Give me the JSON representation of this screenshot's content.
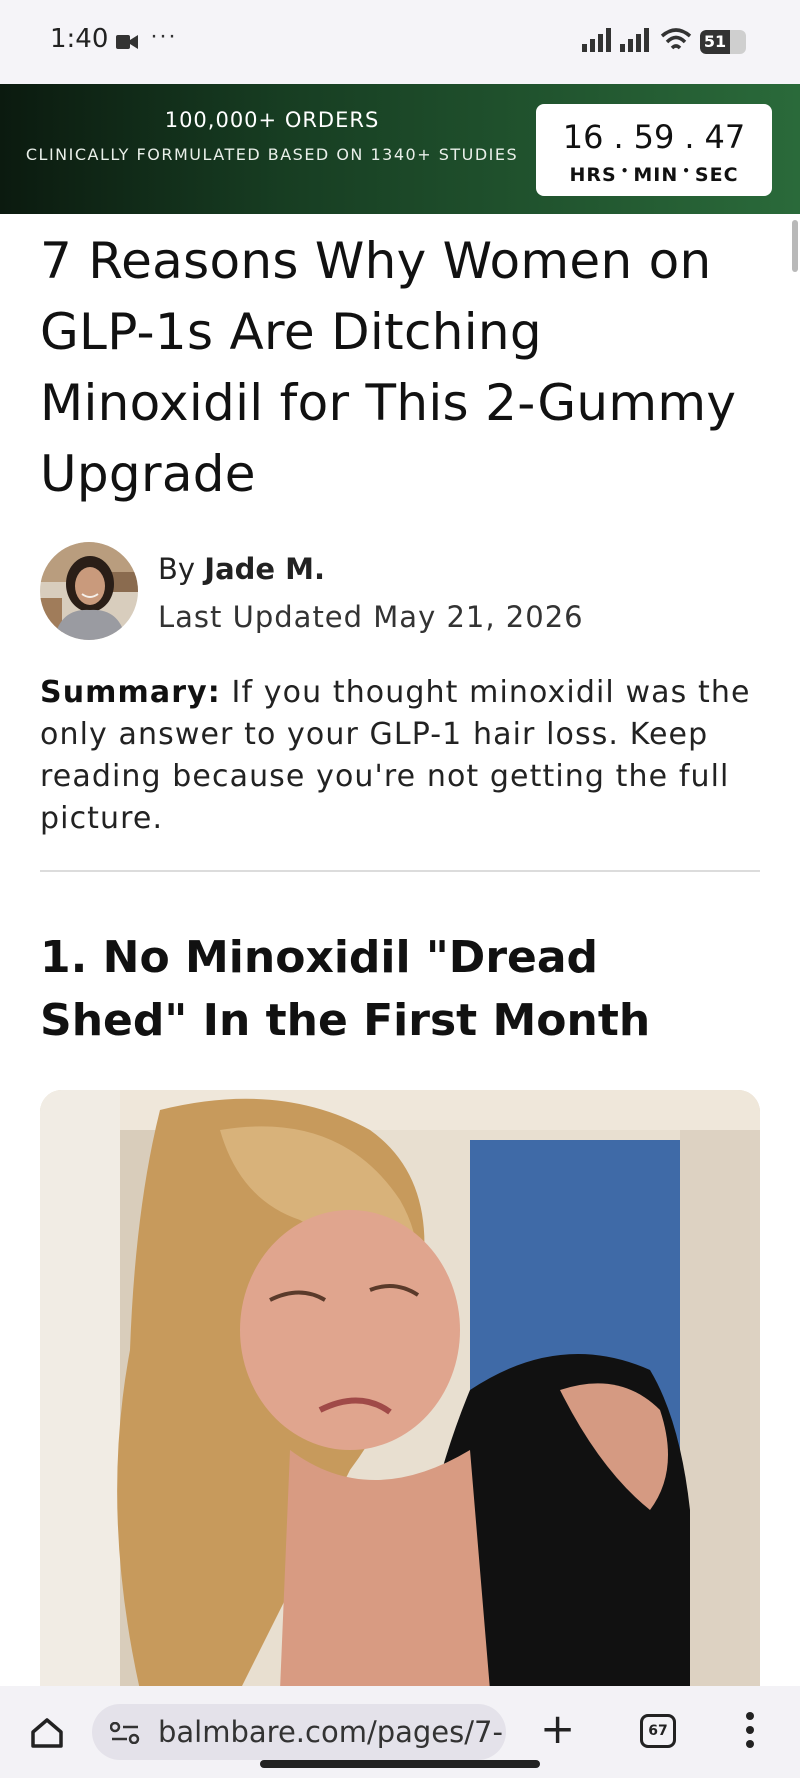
{
  "status_bar": {
    "time": "1:40",
    "overflow": "···",
    "battery_level": "51",
    "icons": [
      "video-camera-icon",
      "signal-icon",
      "wifi-icon",
      "battery-icon"
    ]
  },
  "promo_banner": {
    "title": "100,000+ ORDERS",
    "subtitle": "CLINICALLY FORMULATED BASED ON 1340+ STUDIES",
    "timer": {
      "hours": "16",
      "minutes": "59",
      "seconds": "47",
      "hours_label": "HRS",
      "minutes_label": "MIN",
      "seconds_label": "SEC"
    },
    "colors": {
      "dark": "#0b1a0f",
      "mid": "#173d22",
      "light": "#2a6a3a"
    }
  },
  "article": {
    "headline": "7 Reasons Why Women on GLP-1s Are Ditching Minoxidil for This 2-Gummy Upgrade",
    "byline_prefix": "By",
    "author": "Jade M.",
    "updated": "Last Updated May 21, 2026",
    "summary_label": "Summary:",
    "summary_text": "If you thought minoxidil was the only answer to your GLP-1 hair loss. Keep reading because you're not getting the full picture.",
    "section_1_heading": "1. No Minoxidil \"Dread Shed\" In the First Month"
  },
  "browser_bar": {
    "url": "balmbare.com/pages/7-",
    "tab_count": "67",
    "icons": [
      "home-icon",
      "site-settings-icon",
      "new-tab-icon",
      "tabs-icon",
      "more-menu-icon"
    ]
  }
}
